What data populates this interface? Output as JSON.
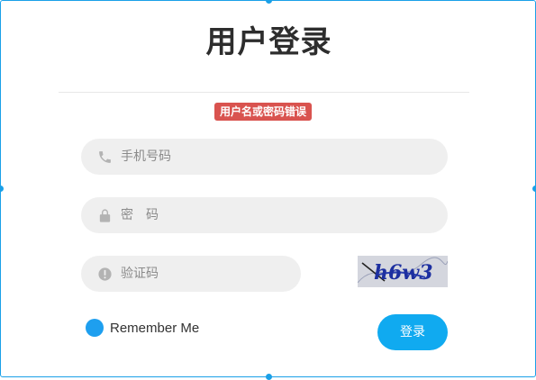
{
  "title": "用户登录",
  "error_message": "用户名或密码错误",
  "fields": {
    "phone": {
      "placeholder": "手机号码",
      "value": "",
      "icon": "phone-icon"
    },
    "password": {
      "placeholder": "密　码",
      "value": "",
      "icon": "lock-icon"
    },
    "captcha": {
      "placeholder": "验证码",
      "value": "",
      "icon": "alert-circle-icon"
    }
  },
  "captcha_image": {
    "text": "h6w3"
  },
  "remember": {
    "label": "Remember Me",
    "checked": true
  },
  "login_button": {
    "label": "登录"
  },
  "colors": {
    "accent": "#1aa0e8",
    "button": "#10aaf0",
    "error": "#d9534f",
    "field_bg": "#efefef"
  }
}
